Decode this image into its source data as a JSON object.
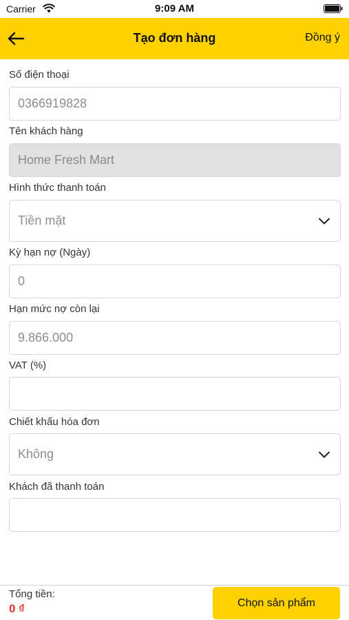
{
  "status_bar": {
    "carrier": "Carrier",
    "time": "9:09 AM"
  },
  "header": {
    "title": "Tạo đơn hàng",
    "action_label": "Đồng ý",
    "back_icon": "arrow-left-icon",
    "background_color": "#FFD100"
  },
  "form": {
    "phone": {
      "label": "Số điện thoại",
      "value": "0366919828"
    },
    "customer_name": {
      "label": "Tên khách hàng",
      "value": "Home Fresh Mart"
    },
    "payment_method": {
      "label": "Hình thức thanh toán",
      "value": "Tiền mặt"
    },
    "debt_term": {
      "label": "Kỳ hạn nợ (Ngày)",
      "value": "0"
    },
    "remaining_debt_limit": {
      "label": "Hạn mức nợ còn lại",
      "value": "9.866.000"
    },
    "vat": {
      "label": "VAT (%)",
      "value": ""
    },
    "invoice_discount": {
      "label": "Chiết khấu hóa đơn",
      "value": "Không"
    },
    "customer_paid": {
      "label": "Khách đã thanh toán",
      "value": ""
    }
  },
  "footer": {
    "total_label": "Tổng tiền:",
    "total_value": "0 ₫",
    "total_color": "#e8322c",
    "choose_products_label": "Chọn sản phẩm"
  }
}
